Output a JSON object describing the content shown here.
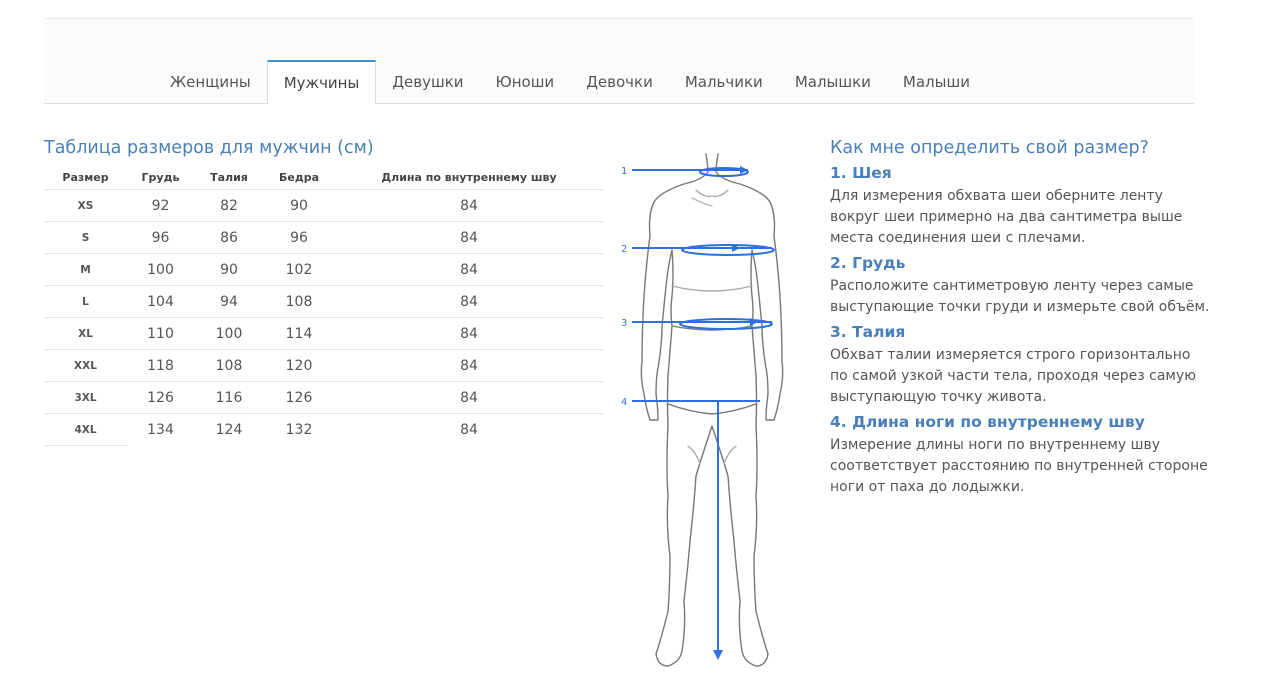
{
  "tabs": [
    {
      "label": "Женщины",
      "active": false
    },
    {
      "label": "Мужчины",
      "active": true
    },
    {
      "label": "Девушки",
      "active": false
    },
    {
      "label": "Юноши",
      "active": false
    },
    {
      "label": "Девочки",
      "active": false
    },
    {
      "label": "Мальчики",
      "active": false
    },
    {
      "label": "Малышки",
      "active": false
    },
    {
      "label": "Малыши",
      "active": false
    }
  ],
  "size_table": {
    "title": "Таблица размеров для мужчин (см)",
    "headers": [
      "Размер",
      "Грудь",
      "Талия",
      "Бедра",
      "Длина по внутреннему шву"
    ],
    "rows": [
      [
        "XS",
        "92",
        "82",
        "90",
        "84"
      ],
      [
        "S",
        "96",
        "86",
        "96",
        "84"
      ],
      [
        "M",
        "100",
        "90",
        "102",
        "84"
      ],
      [
        "L",
        "104",
        "94",
        "108",
        "84"
      ],
      [
        "XL",
        "110",
        "100",
        "114",
        "84"
      ],
      [
        "XXL",
        "118",
        "108",
        "120",
        "84"
      ],
      [
        "3XL",
        "126",
        "116",
        "126",
        "84"
      ],
      [
        "4XL",
        "134",
        "124",
        "132",
        "84"
      ]
    ]
  },
  "figure": {
    "markers": [
      "1",
      "2",
      "3",
      "4"
    ],
    "accent_color": "#2f6fe0"
  },
  "guide": {
    "title": "Как мне определить свой размер?",
    "steps": [
      {
        "title": "1. Шея",
        "text": "Для измерения обхвата шеи оберните ленту вокруг шеи примерно на два сантиметра выше места соединения шеи с плечами."
      },
      {
        "title": "2. Грудь",
        "text": "Расположите сантиметровую ленту через самые выступающие точки груди и измерьте свой объём."
      },
      {
        "title": "3. Талия",
        "text": "Обхват талии измеряется строго горизонтально по самой узкой части тела, проходя через самую выступающую точку живота."
      },
      {
        "title": "4. Длина ноги по внутреннему шву",
        "text": "Измерение длины ноги по внутреннему шву соответствует расстоянию по внутренней стороне ноги от паха до лодыжки."
      }
    ]
  },
  "colors": {
    "heading": "#4a80b8",
    "tab_active_border": "#4a90c8"
  }
}
